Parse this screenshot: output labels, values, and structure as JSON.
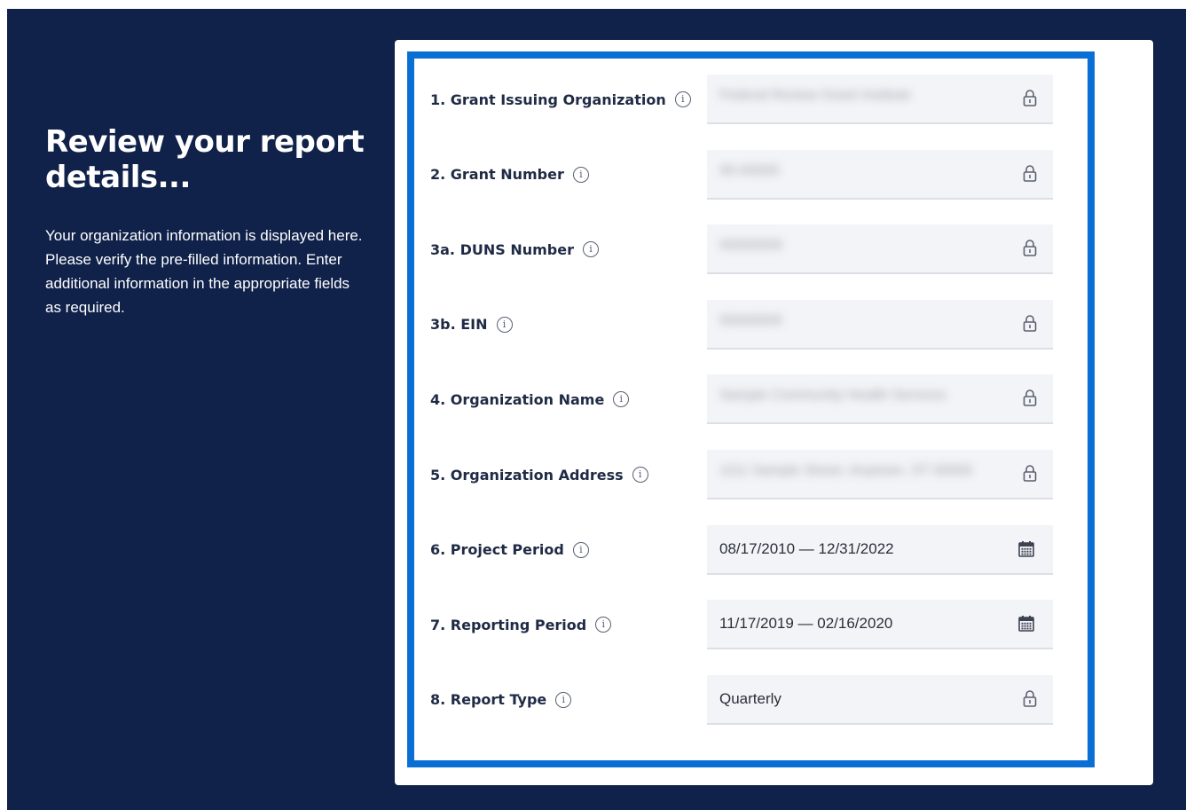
{
  "intro": {
    "heading": "Review your report details...",
    "description": "Your organization information is displayed here. Please verify the pre-filled information. Enter additional information in the appropriate fields as required."
  },
  "form": {
    "fields": [
      {
        "label": "1. Grant Issuing Organization",
        "value": "Federal Review Grant Institute",
        "locked": true,
        "blurred": true
      },
      {
        "label": "2. Grant Number",
        "value": "90-00000",
        "locked": true,
        "blurred": true
      },
      {
        "label": "3a. DUNS Number",
        "value": "00000000",
        "locked": true,
        "blurred": true
      },
      {
        "label": "3b. EIN",
        "value": "00000000",
        "locked": true,
        "blurred": true
      },
      {
        "label": "4. Organization Name",
        "value": "Sample Community Health Services",
        "locked": true,
        "blurred": true
      },
      {
        "label": "5. Organization Address",
        "value": "1111 Sample Street, Anytown, ST 00000",
        "locked": true,
        "blurred": true
      },
      {
        "label": "6. Project Period",
        "value": "08/17/2010 — 12/31/2022",
        "locked": false,
        "blurred": false,
        "icon": "calendar-icon"
      },
      {
        "label": "7. Reporting Period",
        "value": "11/17/2019 — 02/16/2020",
        "locked": false,
        "blurred": false,
        "icon": "calendar-icon"
      },
      {
        "label": "8. Report Type",
        "value": "Quarterly",
        "locked": true,
        "blurred": false
      }
    ]
  },
  "colors": {
    "background": "#10214a",
    "focus_border": "#0a6fd4",
    "field_bg": "#f3f4f7"
  }
}
